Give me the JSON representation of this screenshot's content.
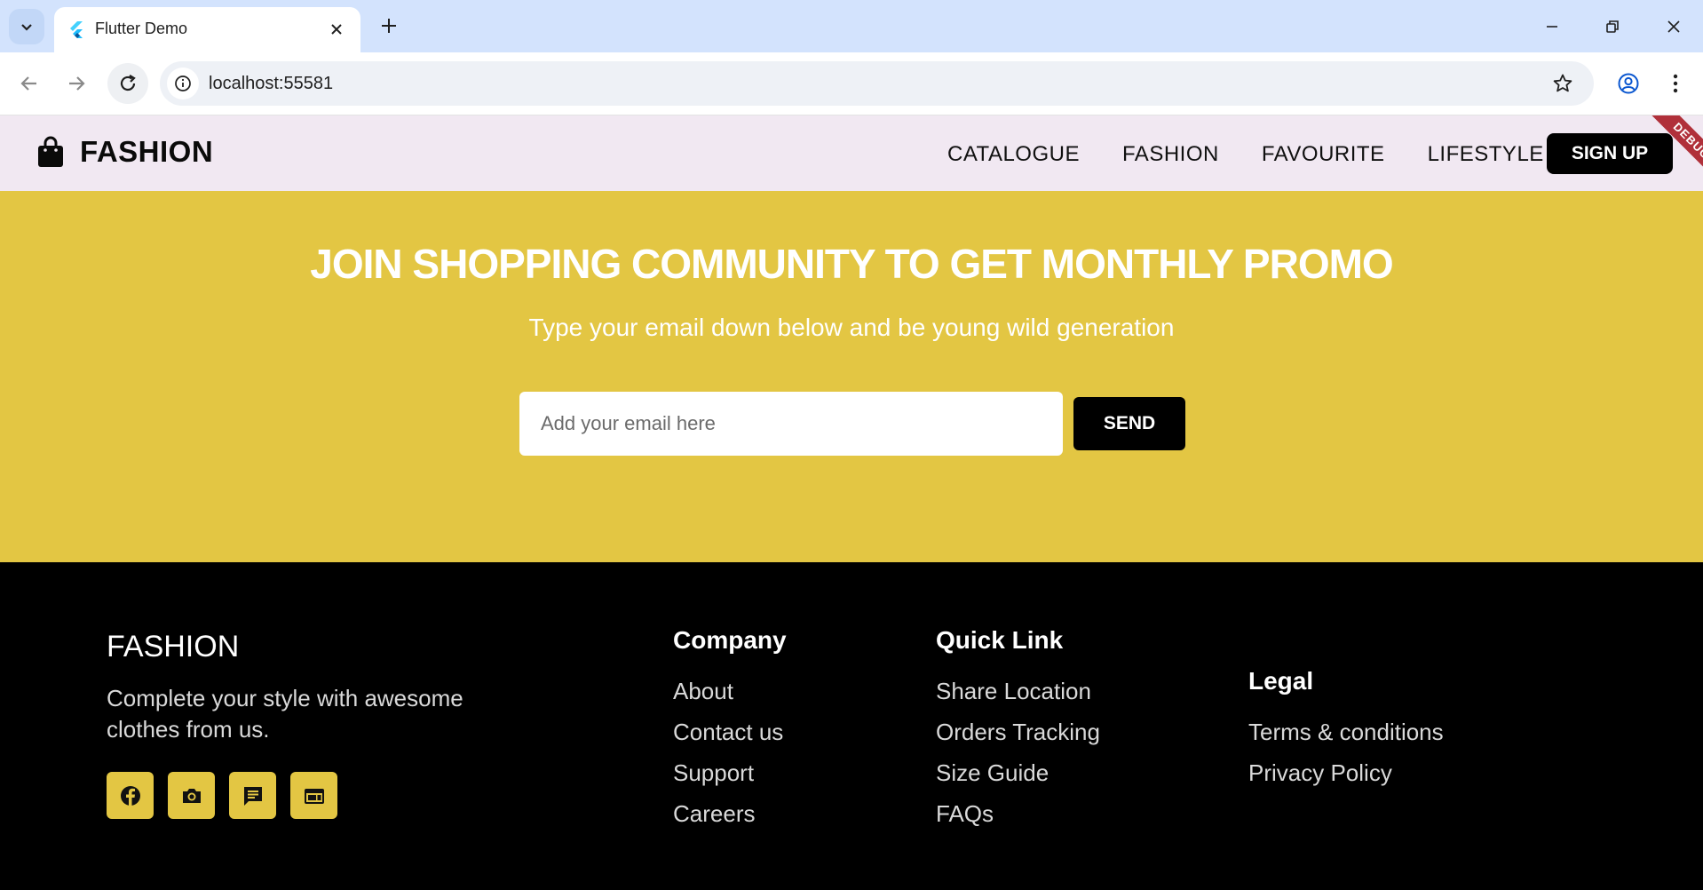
{
  "browser": {
    "tab_title": "Flutter Demo",
    "url": "localhost:55581"
  },
  "header": {
    "brand": "FASHION",
    "nav": [
      "CATALOGUE",
      "FASHION",
      "FAVOURITE",
      "LIFESTYLE"
    ],
    "signup": "SIGN UP",
    "debug": "DEBUG"
  },
  "promo": {
    "title": "JOIN SHOPPING COMMUNITY TO GET MONTHLY PROMO",
    "subtitle": "Type your email down below and be young wild generation",
    "email_placeholder": "Add your email here",
    "send": "SEND"
  },
  "footer": {
    "brand": "FASHION",
    "description": "Complete your style with awesome clothes from us.",
    "socials": [
      "facebook-icon",
      "camera-icon",
      "chat-icon",
      "web-icon"
    ],
    "company": {
      "title": "Company",
      "links": [
        "About",
        "Contact us",
        "Support",
        "Careers"
      ]
    },
    "quick_link": {
      "title": "Quick Link",
      "links": [
        "Share Location",
        "Orders Tracking",
        "Size Guide",
        "FAQs"
      ]
    },
    "legal": {
      "title": "Legal",
      "links": [
        "Terms & conditions",
        "Privacy Policy"
      ]
    }
  },
  "colors": {
    "accent": "#e3c643",
    "header_bg": "#f1e8f2",
    "footer_bg": "#000000"
  }
}
